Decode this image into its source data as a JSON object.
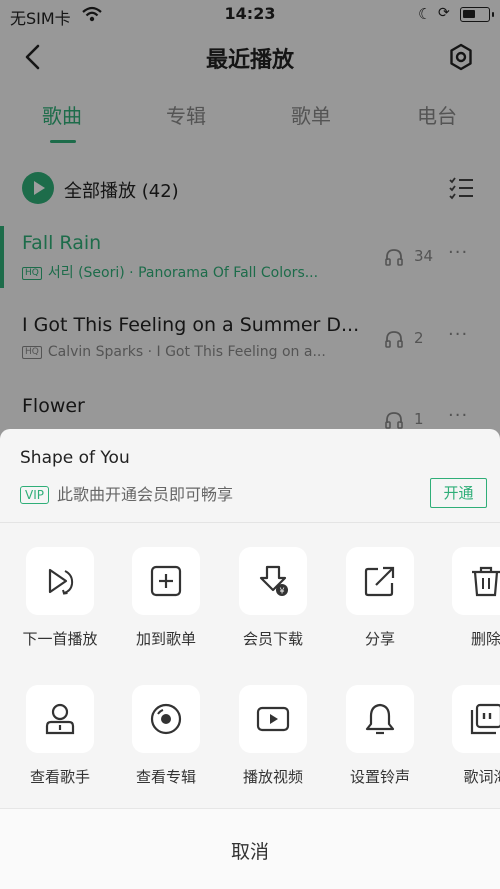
{
  "status_bar": {
    "carrier": "无SIM卡",
    "time": "14:23",
    "battery_level": 0.5
  },
  "nav": {
    "title": "最近播放"
  },
  "tabs": [
    {
      "label": "歌曲",
      "active": true
    },
    {
      "label": "专辑",
      "active": false
    },
    {
      "label": "歌单",
      "active": false
    },
    {
      "label": "电台",
      "active": false
    }
  ],
  "play_all": {
    "label": "全部播放 (42)"
  },
  "songs": [
    {
      "title": "Fall Rain",
      "badge": "HQ",
      "artist": "서리 (Seori)",
      "separator": "·",
      "album": "Panorama Of Fall Colors...",
      "plays": "34",
      "more": "···"
    },
    {
      "title": "I Got This Feeling on a Summer D...",
      "badge": "HQ",
      "artist": "Calvin Sparks",
      "separator": "·",
      "album": "I Got This Feeling on a...",
      "plays": "2",
      "more": "···"
    },
    {
      "title": "Flower",
      "plays": "1",
      "more": "···"
    }
  ],
  "sheet": {
    "song_title": "Shape of You",
    "vip_badge": "VIP",
    "vip_text": "此歌曲开通会员即可畅享",
    "open_label": "开通",
    "actions_row1": [
      {
        "label": "下一首播放",
        "icon": "play-next-icon"
      },
      {
        "label": "加到歌单",
        "icon": "add-to-playlist-icon"
      },
      {
        "label": "会员下载",
        "icon": "vip-download-icon"
      },
      {
        "label": "分享",
        "icon": "share-icon"
      },
      {
        "label": "删除",
        "icon": "trash-icon"
      }
    ],
    "actions_row2": [
      {
        "label": "查看歌手",
        "icon": "artist-icon"
      },
      {
        "label": "查看专辑",
        "icon": "album-disc-icon"
      },
      {
        "label": "播放视频",
        "icon": "video-play-icon"
      },
      {
        "label": "设置铃声",
        "icon": "bell-icon"
      },
      {
        "label": "歌词海",
        "icon": "lyrics-poster-icon"
      }
    ],
    "cancel_label": "取消"
  },
  "colors": {
    "accent": "#2fae78",
    "text": "#222222",
    "muted": "#888888",
    "sheet_bg": "#f5f5f5"
  }
}
